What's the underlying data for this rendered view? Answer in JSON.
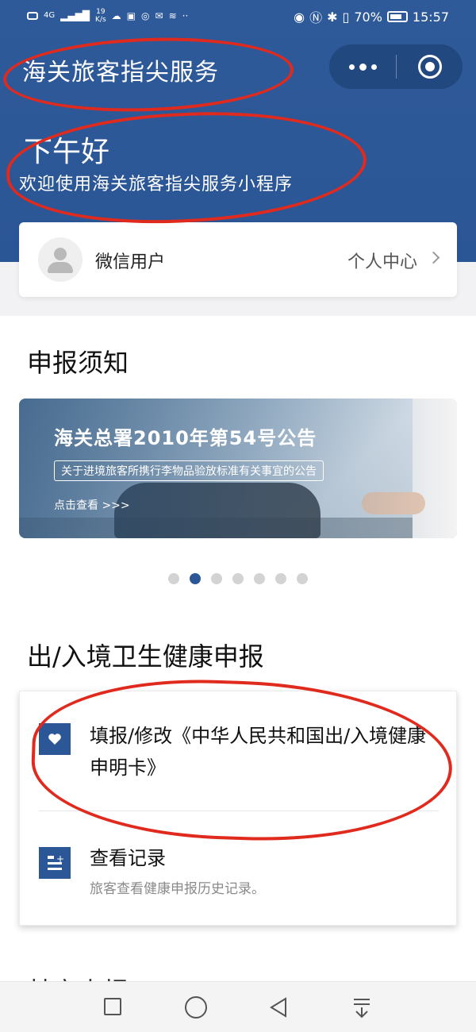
{
  "status_bar": {
    "network": "4G",
    "speed_value": "19",
    "speed_unit": "K/s",
    "battery": "70%",
    "time": "15:57"
  },
  "header": {
    "app_title": "海关旅客指尖服务",
    "greeting": "下午好",
    "welcome": "欢迎使用海关旅客指尖服务小程序",
    "bg_color": "#2c5796"
  },
  "user_card": {
    "name": "微信用户",
    "center_label": "个人中心"
  },
  "notice_section": {
    "title": "申报须知",
    "banner": {
      "title": "海关总署2010年第54号公告",
      "subtitle": "关于进境旅客所携行李物品验放标准有关事宜的公告",
      "link": "点击查看 >>>"
    },
    "carousel": {
      "count": 7,
      "active_index": 1
    }
  },
  "health_section": {
    "title": "出/入境卫生健康申报",
    "items": [
      {
        "label": "填报/修改《中华人民共和国出/入境健康申明卡》",
        "icon": "heart-icon"
      },
      {
        "label": "查看记录",
        "description": "旅客查看健康申报历史记录。",
        "icon": "record-list-icon"
      }
    ]
  },
  "partial_section": {
    "title": "其它申报"
  },
  "annotations": {
    "color": "#e02a1e",
    "count": 3
  },
  "accent_color": "#2c5796"
}
